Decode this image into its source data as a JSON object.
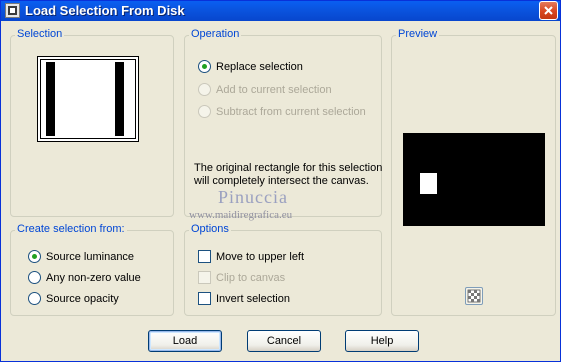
{
  "window": {
    "title": "Load Selection From Disk",
    "close_icon": "close-icon"
  },
  "selection_group": {
    "legend": "Selection"
  },
  "operation_group": {
    "legend": "Operation",
    "options": [
      {
        "label": "Replace selection",
        "checked": true,
        "enabled": true
      },
      {
        "label": "Add to current selection",
        "checked": false,
        "enabled": false
      },
      {
        "label": "Subtract from current selection",
        "checked": false,
        "enabled": false
      }
    ],
    "note": "The original rectangle for this selection will completely intersect the canvas."
  },
  "preview_group": {
    "legend": "Preview"
  },
  "create_group": {
    "legend": "Create selection from:",
    "options": [
      {
        "label": "Source luminance",
        "checked": true
      },
      {
        "label": "Any non-zero value",
        "checked": false
      },
      {
        "label": "Source opacity",
        "checked": false
      }
    ]
  },
  "options_group": {
    "legend": "Options",
    "items": [
      {
        "label": "Move to upper left",
        "checked": false,
        "enabled": true
      },
      {
        "label": "Clip to canvas",
        "checked": false,
        "enabled": false
      },
      {
        "label": "Invert selection",
        "checked": false,
        "enabled": true
      }
    ]
  },
  "watermark": {
    "name": "Pinuccia",
    "site": "www.maidiregrafica.eu"
  },
  "buttons": {
    "load": "Load",
    "cancel": "Cancel",
    "help": "Help"
  },
  "colors": {
    "titlebar": "#0a55e0",
    "legend": "#0046d5",
    "dialog": "#ece9d8",
    "radio_dot": "#21a121"
  }
}
